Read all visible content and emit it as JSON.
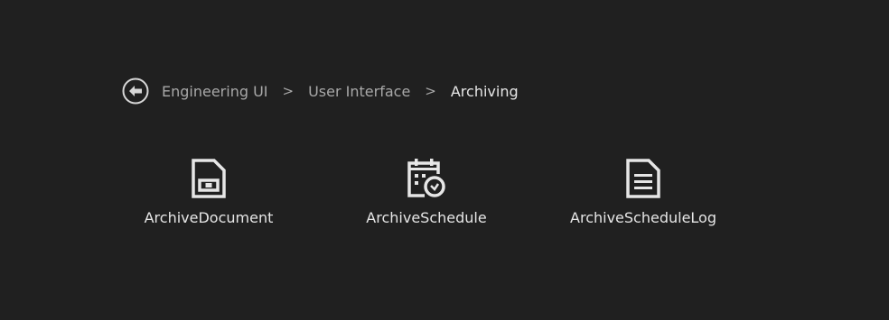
{
  "breadcrumb": {
    "back_icon": "back-arrow-circle-icon",
    "items": [
      {
        "label": "Engineering UI"
      },
      {
        "label": "User Interface"
      },
      {
        "label": "Archiving"
      }
    ],
    "separator": ">"
  },
  "tiles": [
    {
      "label": "ArchiveDocument",
      "icon": "archive-document-icon"
    },
    {
      "label": "ArchiveSchedule",
      "icon": "archive-schedule-icon"
    },
    {
      "label": "ArchiveScheduleLog",
      "icon": "archive-schedule-log-icon"
    }
  ],
  "colors": {
    "background": "#202020",
    "text": "#e6e6e6",
    "muted_text": "#a8a8a8",
    "icon": "#e6e6e6"
  }
}
